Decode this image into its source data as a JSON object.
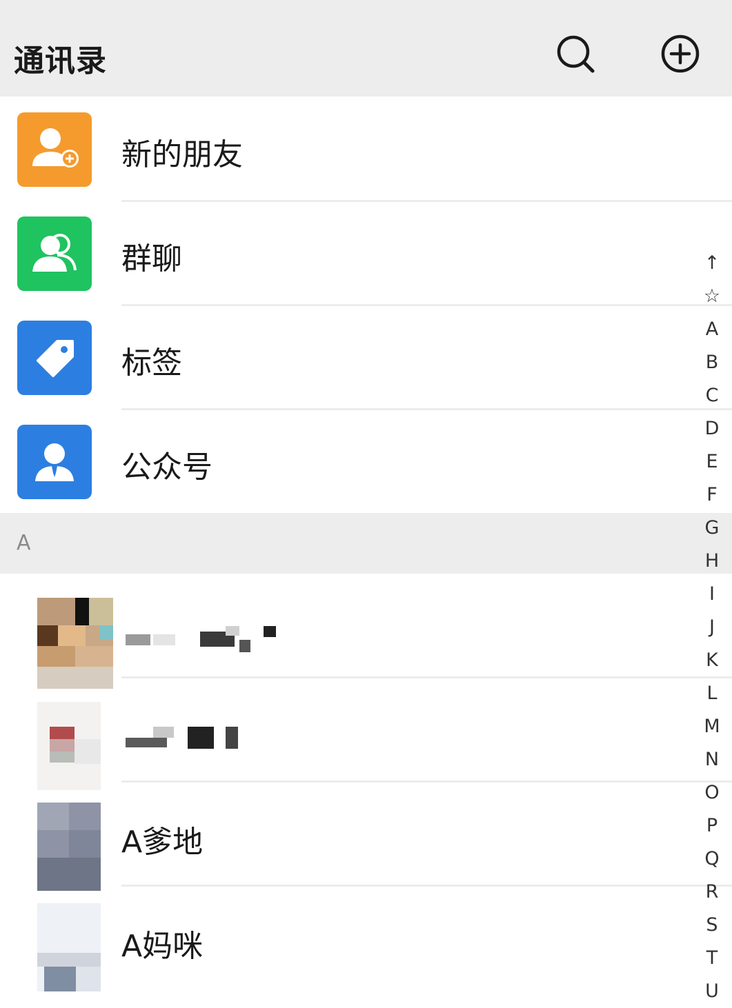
{
  "header": {
    "title": "通讯录",
    "search_icon": "search-icon",
    "add_icon": "add-circle-icon"
  },
  "fixed_items": [
    {
      "label": "新的朋友",
      "icon": "add-friend-icon",
      "color": "#f59b2e"
    },
    {
      "label": "群聊",
      "icon": "group-chat-icon",
      "color": "#1fc35f"
    },
    {
      "label": "标签",
      "icon": "tag-icon",
      "color": "#2c7fe0"
    },
    {
      "label": "公众号",
      "icon": "official-account-icon",
      "color": "#2c7fe0"
    }
  ],
  "section": {
    "letter": "A"
  },
  "contacts": [
    {
      "name": ""
    },
    {
      "name": ""
    },
    {
      "name": "A爹地"
    },
    {
      "name": "A妈咪"
    }
  ],
  "index_bar": [
    "↑",
    "☆",
    "A",
    "B",
    "C",
    "D",
    "E",
    "F",
    "G",
    "H",
    "I",
    "J",
    "K",
    "L",
    "M",
    "N",
    "O",
    "P",
    "Q",
    "R",
    "S",
    "T",
    "U"
  ]
}
